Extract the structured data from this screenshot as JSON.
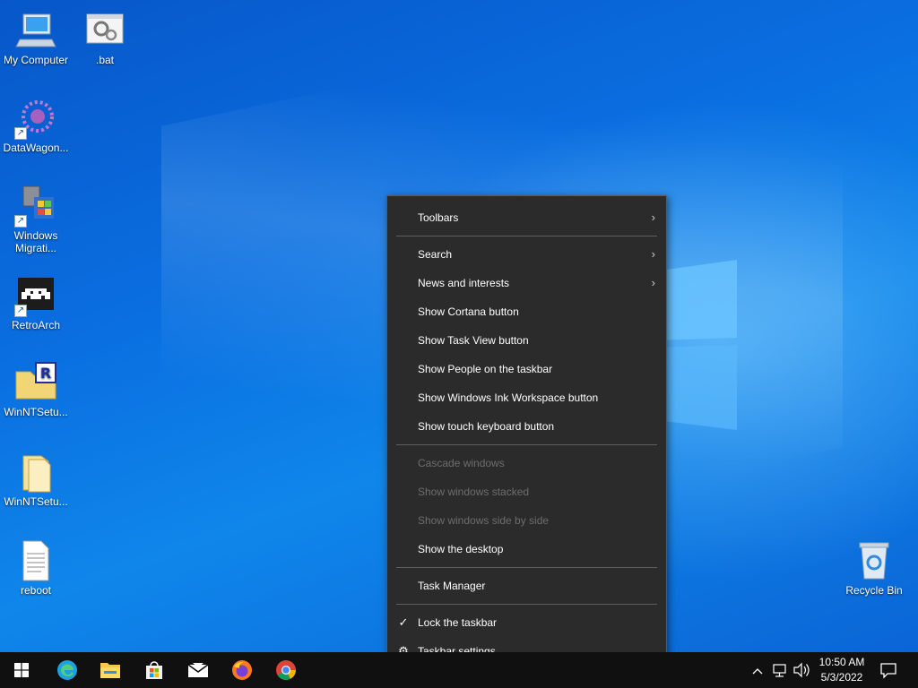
{
  "desktop": {
    "icons": [
      {
        "label": "My Computer",
        "icon": "computer-icon"
      },
      {
        "label": ".bat",
        "icon": "batch-file-icon"
      },
      {
        "label": "DataWagon...",
        "icon": "datawagon-icon"
      },
      {
        "label": "Windows Migrati...",
        "icon": "windows-migration-icon"
      },
      {
        "label": "RetroArch",
        "icon": "retroarch-icon"
      },
      {
        "label": "WinNTSetu...",
        "icon": "winntsetup-r-icon"
      },
      {
        "label": "WinNTSetu...",
        "icon": "folder-icon"
      },
      {
        "label": "reboot",
        "icon": "text-file-icon"
      },
      {
        "label": "Recycle Bin",
        "icon": "recycle-bin-icon"
      }
    ]
  },
  "context_menu": {
    "items": [
      {
        "label": "Toolbars",
        "submenu": true
      },
      {
        "label": "Search",
        "submenu": true
      },
      {
        "label": "News and interests",
        "submenu": true
      },
      {
        "label": "Show Cortana button"
      },
      {
        "label": "Show Task View button"
      },
      {
        "label": "Show People on the taskbar"
      },
      {
        "label": "Show Windows Ink Workspace button"
      },
      {
        "label": "Show touch keyboard button"
      },
      {
        "label": "Cascade windows",
        "disabled": true
      },
      {
        "label": "Show windows stacked",
        "disabled": true
      },
      {
        "label": "Show windows side by side",
        "disabled": true
      },
      {
        "label": "Show the desktop"
      },
      {
        "label": "Task Manager"
      },
      {
        "label": "Lock the taskbar",
        "checked": true
      },
      {
        "label": "Taskbar settings",
        "icon": "gear-icon"
      }
    ],
    "icons": {
      "chevron": "›",
      "check": "✓",
      "gear": "⚙"
    }
  },
  "taskbar": {
    "apps": [
      "start-icon",
      "edge-icon",
      "file-explorer-icon",
      "store-icon",
      "mail-icon",
      "firefox-icon",
      "chrome-icon"
    ],
    "clock": {
      "time": "10:50 AM",
      "date": "5/3/2022"
    },
    "tray": [
      "chevron-up-icon",
      "network-icon",
      "volume-icon",
      "notification-icon"
    ]
  },
  "colors": {
    "menu_bg": "#2b2b2b",
    "taskbar_bg": "#101010",
    "desktop_blue": "#0a6ee0"
  }
}
